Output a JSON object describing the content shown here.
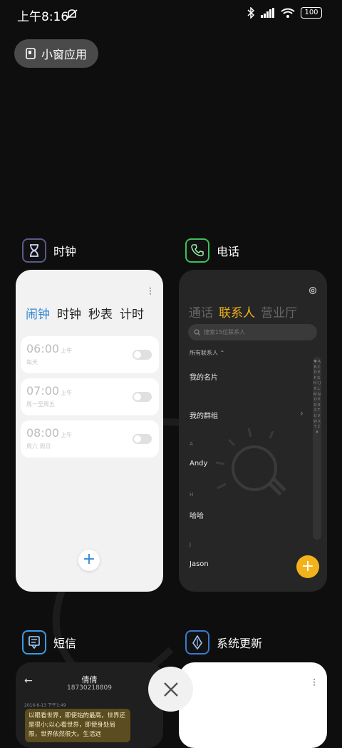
{
  "status": {
    "time": "上午8:16",
    "battery": "100"
  },
  "floating_window_label": "小窗应用",
  "apps": {
    "clock": {
      "name": "时钟",
      "tabs": [
        "闹钟",
        "时钟",
        "秒表",
        "计时"
      ],
      "alarms": [
        {
          "time": "06:00",
          "ampm": "上午",
          "repeat": "每天"
        },
        {
          "time": "07:00",
          "ampm": "上午",
          "repeat": "周一至周五"
        },
        {
          "time": "08:00",
          "ampm": "上午",
          "repeat": "周六 周日"
        }
      ],
      "add": "+"
    },
    "phone": {
      "name": "电话",
      "tabs": [
        "通话",
        "联系人",
        "营业厅"
      ],
      "search_placeholder": "搜索15位联系人",
      "filter": "所有联系人",
      "my_card": "我的名片",
      "my_groups": "我的群组",
      "sections": [
        {
          "letter": "A",
          "name": "Andy"
        },
        {
          "letter": "H",
          "name": "哈哈"
        },
        {
          "letter": "J",
          "name": "Jason"
        }
      ],
      "index_letters": "♥ A B C D E F G H I J K L M N O P Q R S T U V W X Y Z #",
      "add": "+"
    },
    "sms": {
      "name": "短信",
      "contact_name": "倩倩",
      "contact_number": "18730218809",
      "timestamp": "2016-6-13 下午1:49",
      "message": "以眼看世界，即使站的最高，世界还是很小;以心看世界，即使身处局限，世界依然很大。生活远"
    },
    "update": {
      "name": "系统更新"
    }
  },
  "colors": {
    "accent_blue": "#2f86d6",
    "accent_orange": "#f2b21c"
  }
}
